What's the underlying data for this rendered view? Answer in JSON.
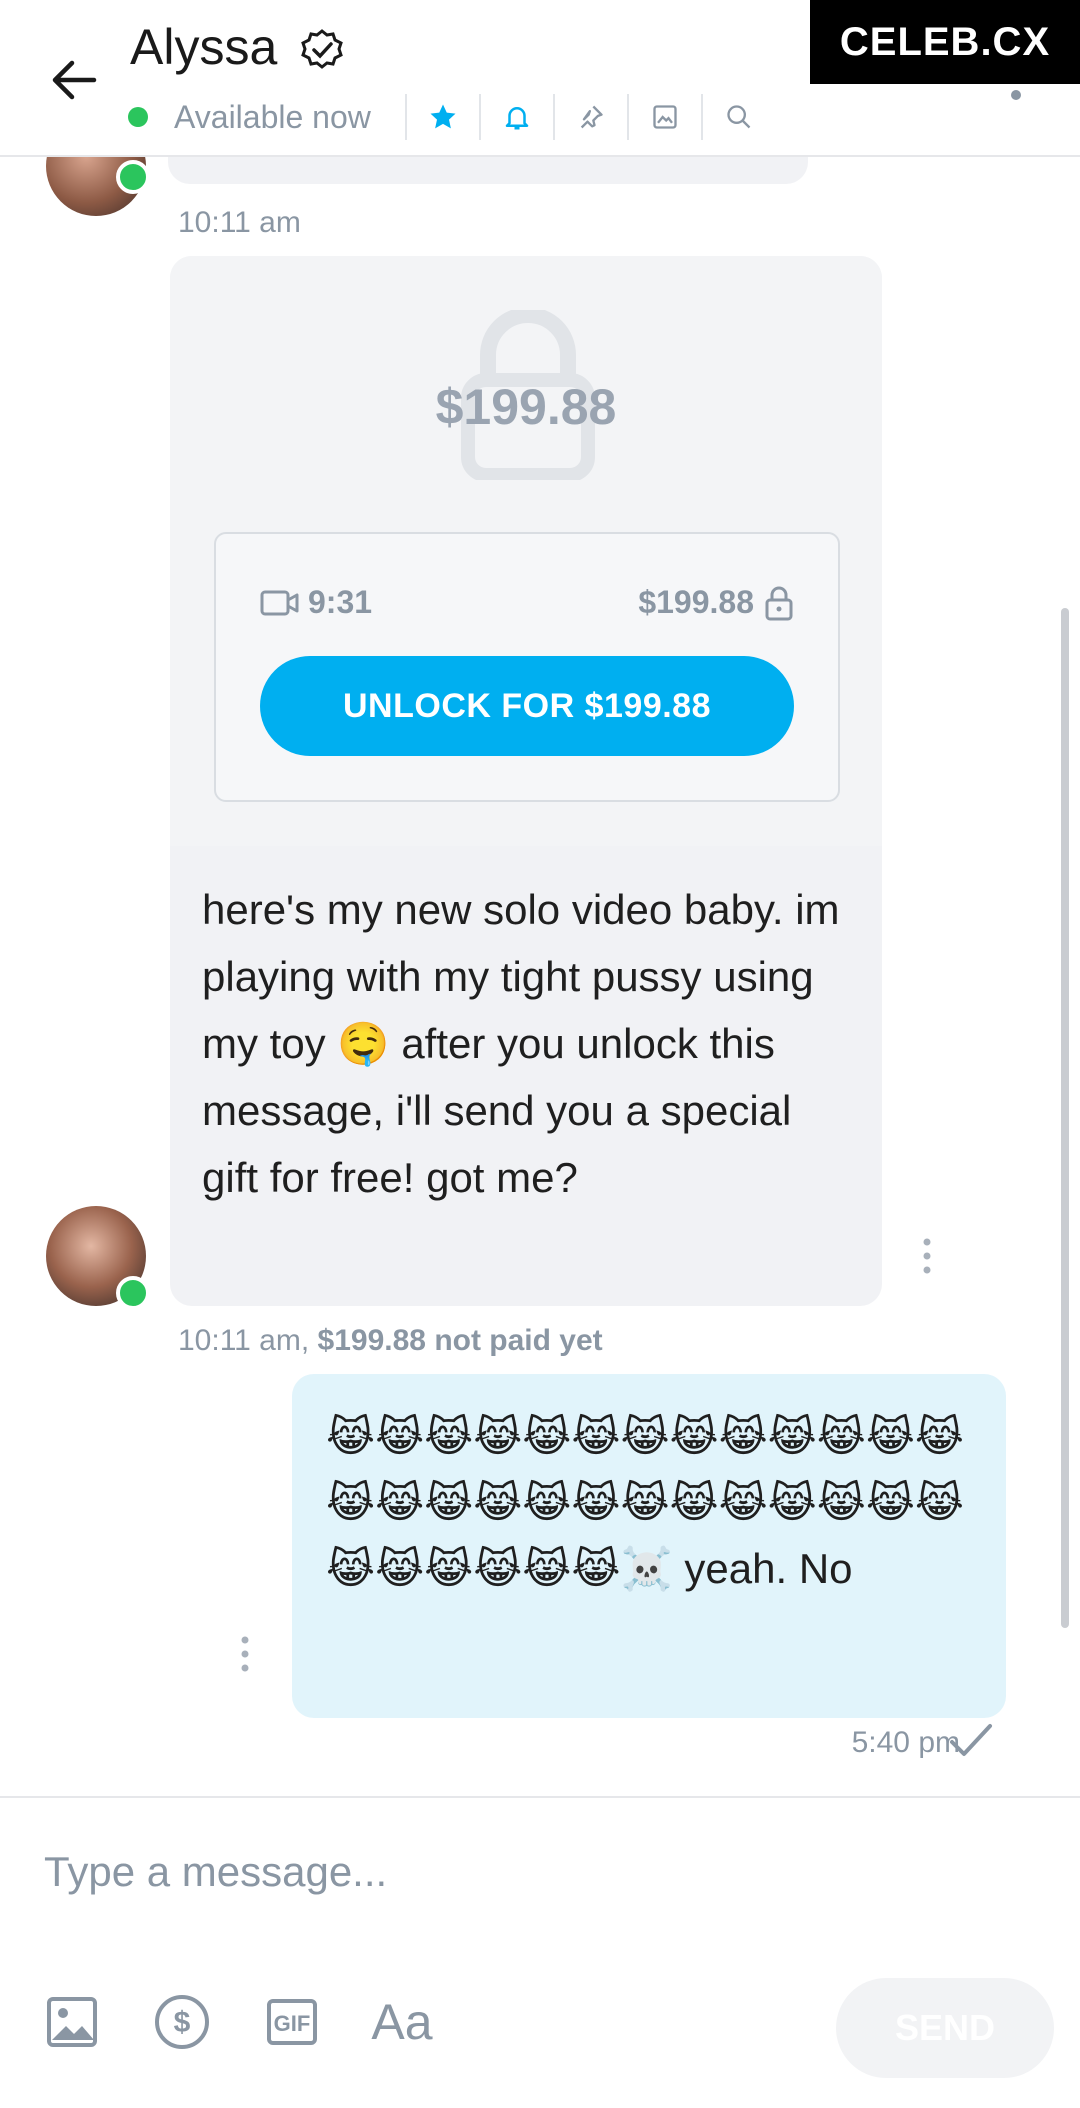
{
  "header": {
    "name": "Alyssa",
    "status": "Available now",
    "watermark": "CELEB.CX"
  },
  "feed": {
    "first_time": "10:11 am",
    "locked_message": {
      "big_price": "$199.88",
      "video_duration": "9:31",
      "price": "$199.88",
      "unlock_label": "UNLOCK FOR $199.88",
      "text": "here's my new solo video baby. im playing with my tight pussy using my toy 🤤 after you unlock this message, i'll send you a special gift for free! got me?",
      "time": "10:11 am,",
      "paid_status": "$199.88 not paid yet"
    },
    "my_message": {
      "text": "😹😹😹😹😹😹😹😹😹😹😹😹😹😹😹😹😹😹😹😹😹😹😹😹😹😹😹😹😹😹😹😹☠️ yeah. No",
      "time": "5:40 pm"
    }
  },
  "composer": {
    "placeholder": "Type a message...",
    "text_format": "Aa",
    "send_label": "SEND"
  },
  "colors": {
    "accent": "#00aff0",
    "online": "#2bc55d",
    "muted": "#8a96a3",
    "my_bubble": "#e1f4fb",
    "their_bubble": "#f1f2f5"
  }
}
